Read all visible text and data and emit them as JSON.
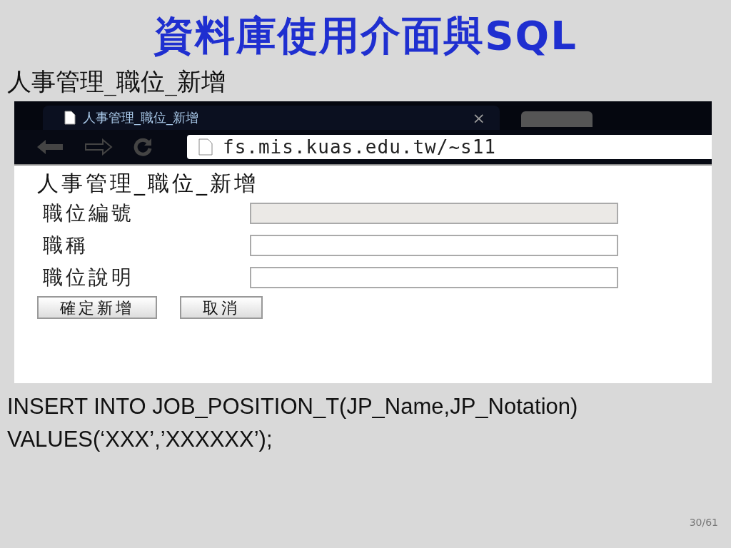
{
  "title": "資料庫使用介面與SQL",
  "subtitle": "人事管理_職位_新增",
  "browser": {
    "tab_title": "人事管理_職位_新增",
    "tab_close": "×",
    "url": "fs.mis.kuas.edu.tw/~s11",
    "page": {
      "heading": "人事管理_職位_新增",
      "fields": [
        {
          "label": "職位編號",
          "disabled": true
        },
        {
          "label": "職稱",
          "disabled": false
        },
        {
          "label": "職位說明",
          "disabled": false
        }
      ],
      "buttons": [
        "確定新增",
        "取消"
      ]
    }
  },
  "sql": [
    "INSERT INTO JOB_POSITION_T(JP_Name,JP_Notation)",
    "VALUES(‘XXX’,’XXXXXX’);"
  ],
  "page_number": "30/61"
}
